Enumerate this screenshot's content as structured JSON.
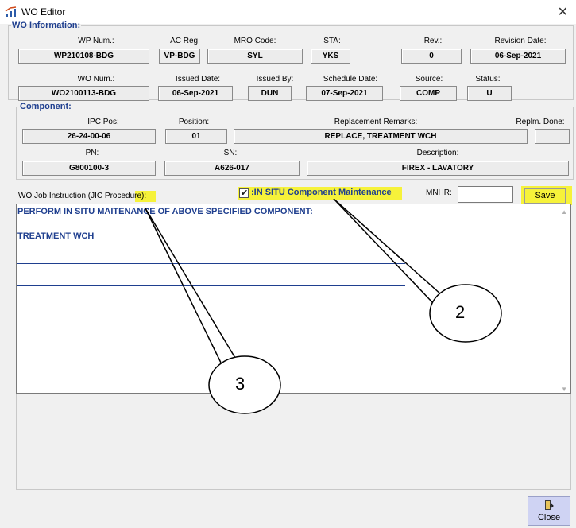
{
  "window": {
    "title": "WO Editor",
    "close_glyph": "✕"
  },
  "wo_info": {
    "legend": "WO Information:",
    "wp_num": {
      "label": "WP Num.:",
      "value": "WP210108-BDG"
    },
    "ac_reg": {
      "label": "AC Reg:",
      "value": "VP-BDG"
    },
    "mro_code": {
      "label": "MRO Code:",
      "value": "SYL"
    },
    "sta": {
      "label": "STA:",
      "value": "YKS"
    },
    "rev": {
      "label": "Rev.:",
      "value": "0"
    },
    "revision_date": {
      "label": "Revision Date:",
      "value": "06-Sep-2021"
    },
    "wo_num": {
      "label": "WO Num.:",
      "value": "WO2100113-BDG"
    },
    "issued_date": {
      "label": "Issued Date:",
      "value": "06-Sep-2021"
    },
    "issued_by": {
      "label": "Issued By:",
      "value": "DUN"
    },
    "schedule_date": {
      "label": "Schedule Date:",
      "value": "07-Sep-2021"
    },
    "source": {
      "label": "Source:",
      "value": "COMP"
    },
    "status": {
      "label": "Status:",
      "value": "U"
    }
  },
  "component": {
    "legend": "Component:",
    "ipc_pos": {
      "label": "IPC Pos:",
      "value": "26-24-00-06"
    },
    "position": {
      "label": "Position:",
      "value": "01"
    },
    "replacement_remarks": {
      "label": "Replacement Remarks:",
      "value": "REPLACE, TREATMENT WCH"
    },
    "replm_done": {
      "label": "Replm. Done:",
      "value": ""
    },
    "pn": {
      "label": "PN:",
      "value": "G800100-3"
    },
    "sn": {
      "label": "SN:",
      "value": "A626-017"
    },
    "description": {
      "label": "Description:",
      "value": "FIREX - LAVATORY"
    }
  },
  "job_instruction": {
    "label": "WO Job Instruction (JIC Procedure):",
    "in_situ_checked": true,
    "in_situ_label": ":IN SITU Component Maintenance",
    "mnhr_label": "MNHR:",
    "mnhr_value": "",
    "save_label": "Save",
    "text_line1": "PERFORM IN SITU MAITENANCE OF ABOVE SPECIFIED COMPONENT:",
    "text_line2": "TREATMENT WCH"
  },
  "footer": {
    "close_label": "Close"
  },
  "annotations": [
    {
      "number": "2"
    },
    {
      "number": "3"
    }
  ],
  "colors": {
    "highlight": "#f6f23a",
    "accent_blue": "#1f3f8f",
    "close_button_bg": "#cfd3f3"
  }
}
